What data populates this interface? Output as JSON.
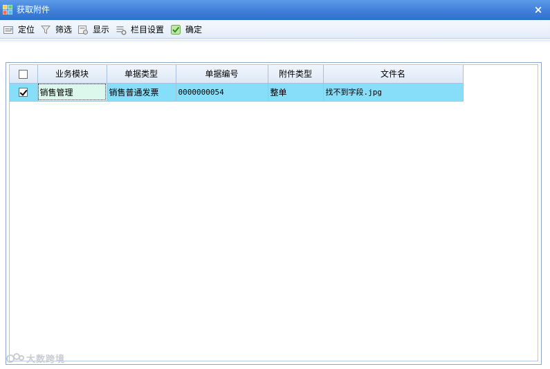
{
  "window": {
    "title": "获取附件",
    "close_glyph": "×"
  },
  "toolbar": {
    "items": [
      {
        "label": "定位",
        "icon": "locate-icon"
      },
      {
        "label": "筛选",
        "icon": "filter-icon"
      },
      {
        "label": "显示",
        "icon": "display-icon"
      },
      {
        "label": "栏目设置",
        "icon": "column-settings-icon"
      },
      {
        "label": "确定",
        "icon": "confirm-icon"
      }
    ]
  },
  "grid": {
    "columns": [
      "",
      "业务模块",
      "单据类型",
      "单据编号",
      "附件类型",
      "文件名"
    ],
    "header_checked": false,
    "rows": [
      {
        "checked": true,
        "module": "销售管理",
        "doc_type": "销售普通发票",
        "doc_no": "0000000054",
        "attach_type": "整单",
        "file_name": "找不到字段.jpg"
      }
    ]
  },
  "watermark": {
    "text": "大数跨境"
  },
  "colors": {
    "titlebar": "#3f7fd9",
    "selected_row": "#87def8",
    "active_cell": "#dcf8ec",
    "header": "#dde8f6"
  }
}
